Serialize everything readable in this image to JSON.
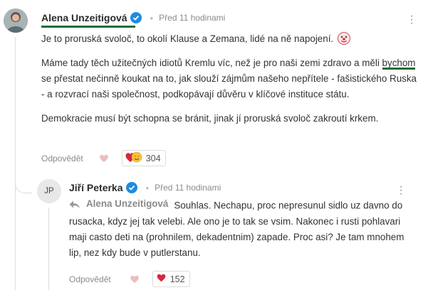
{
  "comments": [
    {
      "author": "Alena Unzeitigová",
      "verified": true,
      "time": "Před 11 hodinami",
      "paragraphs": [
        "Je to proruská svoloč, to okolí Klause a Zemana, lidé na ně napojení.",
        "Máme tady těch užitečných idiotů Kremlu víc, než je pro naši zemi zdravo a měli bychom se přestat nečinně koukat na to, jak slouží zájmům našeho nepřítele - fašistického Ruska - a rozvrací naši společnost, podkopávají důvěru v klíčové instituce státu.",
        "Demokracie musí být schopna se bránit, jinak jí proruská svoloč zakroutí krkem."
      ],
      "p2_before": "Máme tady těch užitečných idiotů Kremlu víc, než je pro naši zemi zdravo a měli ",
      "p2_highlight": "bychom se přestat nečinně koukat na to",
      "p2_after": ", jak slouží zájmům našeho nepřítele - fašistického Ruska - a rozvrací naši společnost, podkopávají důvěru v klíčové instituce státu.",
      "reply_label": "Odpovědět",
      "reaction_count": "304"
    }
  ],
  "reply": {
    "initials": "JP",
    "author": "Jiří Peterka",
    "verified": true,
    "time": "Před 11 hodinami",
    "reply_to": "Alena Unzeitigová",
    "text": "Souhlas. Nechapu, proc nepresunul sidlo uz davno do rusacka, kdyz jej tak velebi. Ale ono je to tak se vsim. Nakonec i rusti pohlavari maji casto deti na (prohnilem, dekadentnim) zapade. Proc asi? Je tam mnohem lip, nez kdy bude v putlerstanu.",
    "reply_label": "Odpovědět",
    "reaction_count": "152"
  },
  "colors": {
    "verified": "#1d8ce0",
    "highlight_underline": "#1f6b3a",
    "heart": "#d7263d"
  },
  "icons": [
    "verified-icon",
    "more-menu-icon",
    "heart-icon",
    "reply-arrow-icon",
    "clown-emoji-icon",
    "heart-eyes-emoji-icon"
  ]
}
